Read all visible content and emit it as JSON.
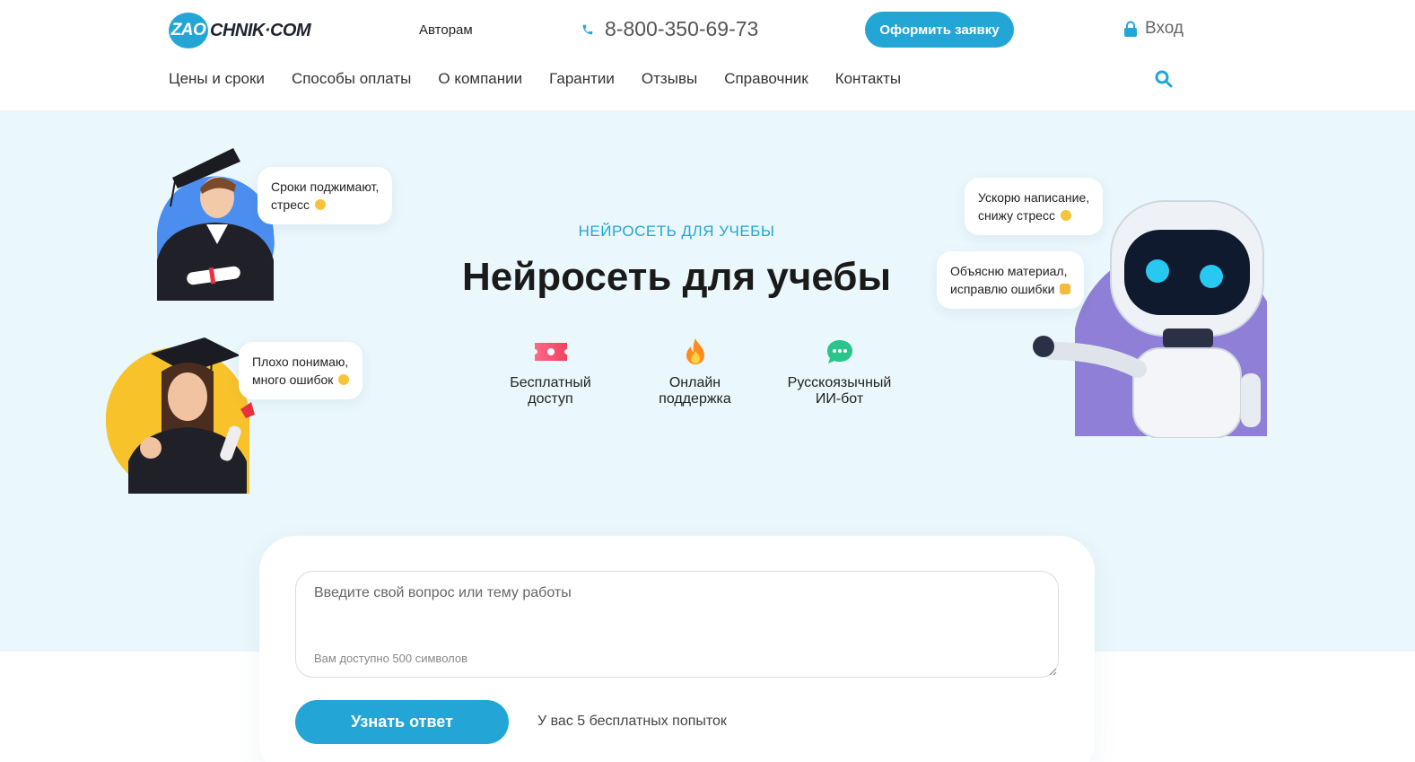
{
  "header": {
    "logo": {
      "circle_text": "ZAO",
      "rest_text": "CHNIK·COM"
    },
    "authors_link": "Авторам",
    "phone": "8-800-350-69-73",
    "apply_button": "Оформить заявку",
    "login": "Вход",
    "nav": [
      "Цены и сроки",
      "Способы оплаты",
      "О компании",
      "Гарантии",
      "Отзывы",
      "Справочник",
      "Контакты"
    ]
  },
  "hero": {
    "subtitle": "НЕЙРОСЕТЬ ДЛЯ УЧЕБЫ",
    "title": "Нейросеть для учебы",
    "features": [
      {
        "line1": "Бесплатный",
        "line2": "доступ",
        "icon": "ticket-icon"
      },
      {
        "line1": "Онлайн",
        "line2": "поддержка",
        "icon": "flame-icon"
      },
      {
        "line1": "Русскоязычный",
        "line2": "ИИ-бот",
        "icon": "chat-bubble-icon"
      }
    ],
    "bubbles": {
      "student_male": {
        "line1": "Сроки поджимают,",
        "line2": "стресс"
      },
      "student_female": {
        "line1": "Плохо понимаю,",
        "line2": "много ошибок"
      },
      "robot_top": {
        "line1": "Ускорю написание,",
        "line2": "снижу стресс"
      },
      "robot_bottom": {
        "line1": "Объясню материал,",
        "line2": "исправлю ошибки"
      }
    }
  },
  "form": {
    "question_placeholder": "Введите свой вопрос или тему работы",
    "char_hint": "Вам доступно 500 символов",
    "submit_button": "Узнать ответ",
    "attempts_text": "У вас 5 бесплатных попыток"
  },
  "colors": {
    "accent": "#23a6d5",
    "hero_bg": "#eaf7fc",
    "blue_blob": "#4b8ef0",
    "yellow_blob": "#f8c32a",
    "purple_blob": "#8f7fd6"
  }
}
